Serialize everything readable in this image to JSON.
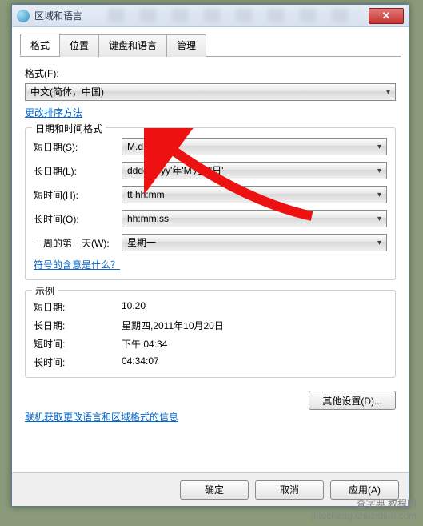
{
  "window": {
    "title": "区域和语言"
  },
  "tabs": [
    "格式",
    "位置",
    "键盘和语言",
    "管理"
  ],
  "format": {
    "label": "格式(F):",
    "value": "中文(简体，中国)",
    "sort_link": "更改排序方法"
  },
  "datetime_group": {
    "title": "日期和时间格式",
    "short_date_label": "短日期(S):",
    "short_date_value": "M.d",
    "long_date_label": "长日期(L):",
    "long_date_value": "dddd,yyyy'年'M'月'd'日'",
    "short_time_label": "短时间(H):",
    "short_time_value": "tt hh:mm",
    "long_time_label": "长时间(O):",
    "long_time_value": "hh:mm:ss",
    "first_day_label": "一周的第一天(W):",
    "first_day_value": "星期一",
    "meaning_link": "符号的含意是什么？"
  },
  "examples": {
    "title": "示例",
    "short_date_label": "短日期:",
    "short_date_value": "10.20",
    "long_date_label": "长日期:",
    "long_date_value": "星期四,2011年10月20日",
    "short_time_label": "短时间:",
    "short_time_value": "下午 04:34",
    "long_time_label": "长时间:",
    "long_time_value": "04:34:07"
  },
  "other_settings_btn": "其他设置(D)...",
  "online_link": "联机获取更改语言和区域格式的信息",
  "buttons": {
    "ok": "确定",
    "cancel": "取消",
    "apply": "应用(A)"
  },
  "watermark": "查字典 教程网\njiaocheng.chazidian.com"
}
